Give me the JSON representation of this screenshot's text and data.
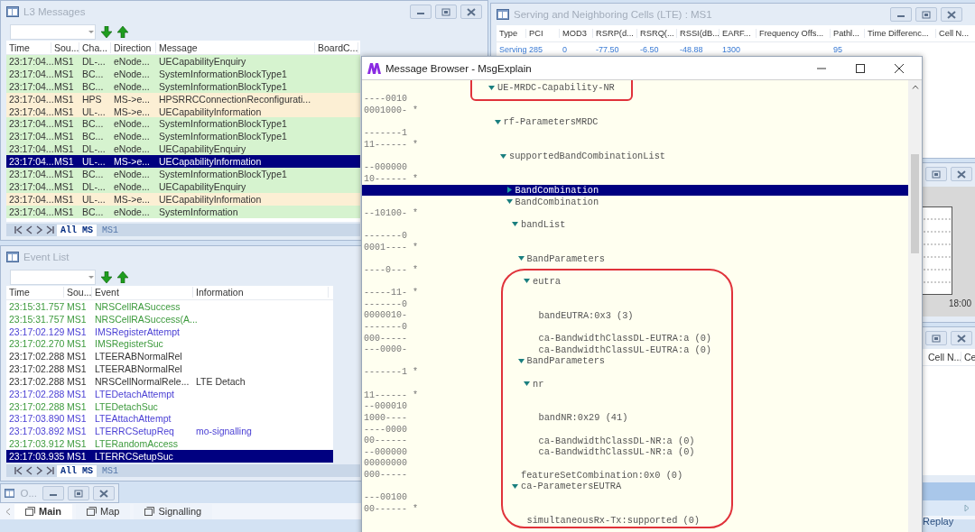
{
  "l3_messages": {
    "title": "L3 Messages",
    "columns": [
      "Time",
      "Sou...",
      "Cha...",
      "Direction",
      "Message",
      "BoardC..."
    ],
    "rows": [
      {
        "time": "23:17:04...",
        "source": "MS1",
        "channel": "DL-...",
        "direction": "eNode...",
        "message": "UECapabilityEnquiry",
        "color": "#d6f3cf",
        "selected": false
      },
      {
        "time": "23:17:04...",
        "source": "MS1",
        "channel": "BC...",
        "direction": "eNode...",
        "message": "SystemInformationBlockType1",
        "color": "#d6f3cf",
        "selected": false
      },
      {
        "time": "23:17:04...",
        "source": "MS1",
        "channel": "BC...",
        "direction": "eNode...",
        "message": "SystemInformationBlockType1",
        "color": "#d6f3cf",
        "selected": false
      },
      {
        "time": "23:17:04...",
        "source": "MS1",
        "channel": "HPS",
        "direction": "MS->e...",
        "message": "HPSRRCConnectionReconfigurati...",
        "color": "#fcefd4",
        "selected": false
      },
      {
        "time": "23:17:04...",
        "source": "MS1",
        "channel": "UL-...",
        "direction": "MS->e...",
        "message": "UECapabilityInformation",
        "color": "#fcefd4",
        "selected": false
      },
      {
        "time": "23:17:04...",
        "source": "MS1",
        "channel": "BC...",
        "direction": "eNode...",
        "message": "SystemInformationBlockType1",
        "color": "#d6f3cf",
        "selected": false
      },
      {
        "time": "23:17:04...",
        "source": "MS1",
        "channel": "BC...",
        "direction": "eNode...",
        "message": "SystemInformationBlockType1",
        "color": "#d6f3cf",
        "selected": false
      },
      {
        "time": "23:17:04...",
        "source": "MS1",
        "channel": "DL-...",
        "direction": "eNode...",
        "message": "UECapabilityEnquiry",
        "color": "#d6f3cf",
        "selected": false
      },
      {
        "time": "23:17:04...",
        "source": "MS1",
        "channel": "UL-...",
        "direction": "MS->e...",
        "message": "UECapabilityInformation",
        "selected": true
      },
      {
        "time": "23:17:04...",
        "source": "MS1",
        "channel": "BC...",
        "direction": "eNode...",
        "message": "SystemInformationBlockType1",
        "color": "#d6f3cf",
        "selected": false
      },
      {
        "time": "23:17:04...",
        "source": "MS1",
        "channel": "DL-...",
        "direction": "eNode...",
        "message": "UECapabilityEnquiry",
        "color": "#d6f3cf",
        "selected": false
      },
      {
        "time": "23:17:04...",
        "source": "MS1",
        "channel": "UL-...",
        "direction": "MS->e...",
        "message": "UECapabilityInformation",
        "color": "#fcefd4",
        "selected": false
      },
      {
        "time": "23:17:04...",
        "source": "MS1",
        "channel": "BC...",
        "direction": "eNode...",
        "message": "SystemInformation",
        "color": "#d6f3cf",
        "selected": false
      }
    ],
    "tabs": [
      {
        "label": "All MS",
        "selected": true
      },
      {
        "label": "MS1",
        "selected": false
      }
    ]
  },
  "event_list": {
    "title": "Event List",
    "columns": [
      "Time",
      "Sou...",
      "Event",
      "Information"
    ],
    "rows": [
      {
        "time": "23:15:31.757",
        "source": "MS1",
        "event": "NRSCellRASuccess",
        "color": "#3d9a3d",
        "selected": false
      },
      {
        "time": "23:15:31.757",
        "source": "MS1",
        "event": "NRSCellRASuccess(A...",
        "color": "#3d9a3d",
        "selected": false
      },
      {
        "time": "23:17:02.129",
        "source": "MS1",
        "event": "IMSRegisterAttempt",
        "color": "#4a3fd4",
        "selected": false
      },
      {
        "time": "23:17:02.270",
        "source": "MS1",
        "event": "IMSRegisterSuc",
        "color": "#3d9a3d",
        "selected": false
      },
      {
        "time": "23:17:02.288",
        "source": "MS1",
        "event": "LTEERABNormalRel",
        "color": "#333333",
        "selected": false
      },
      {
        "time": "23:17:02.288",
        "source": "MS1",
        "event": "LTEERABNormalRel",
        "color": "#333333",
        "selected": false
      },
      {
        "time": "23:17:02.288",
        "source": "MS1",
        "event": "NRSCellNormalRele...",
        "information": "LTE Detach",
        "color": "#333333",
        "selected": false
      },
      {
        "time": "23:17:02.288",
        "source": "MS1",
        "event": "LTEDetachAttempt",
        "color": "#4a3fd4",
        "selected": false
      },
      {
        "time": "23:17:02.288",
        "source": "MS1",
        "event": "LTEDetachSuc",
        "color": "#3d9a3d",
        "selected": false
      },
      {
        "time": "23:17:03.890",
        "source": "MS1",
        "event": "LTEAttachAttempt",
        "color": "#4a3fd4",
        "selected": false
      },
      {
        "time": "23:17:03.892",
        "source": "MS1",
        "event": "LTERRCSetupReq",
        "information": "mo-signalling",
        "color": "#4a3fd4",
        "selected": false
      },
      {
        "time": "23:17:03.912",
        "source": "MS1",
        "event": "LTERandomAccess",
        "color": "#3d9a3d",
        "selected": false
      },
      {
        "time": "23:17:03.935",
        "source": "MS1",
        "event": "LTERRCSetupSuc",
        "selected": true
      }
    ],
    "tabs": [
      {
        "label": "All MS",
        "selected": true
      },
      {
        "label": "MS1",
        "selected": false
      }
    ]
  },
  "serving_cells": {
    "title": "Serving and Neighboring Cells (LTE) : MS1",
    "columns": [
      "Type",
      "PCI",
      "MOD3",
      "RSRP(d...",
      "RSRQ(...",
      "RSSI(dB...",
      "EARF...",
      "Frequency Offs...",
      "Pathl...",
      "Time Differenc...",
      "Cell N..."
    ],
    "rows": [
      [
        "Serving",
        "285",
        "0",
        "-77.50",
        "-6.50",
        "-48.88",
        "1300",
        null,
        "95",
        null,
        null
      ]
    ]
  },
  "message_browser": {
    "title": "Message Browser - MsgExplain",
    "tree": [
      {
        "label": "UE-MRDC-Capability-NR",
        "expanded": true,
        "selected": false,
        "children": [
          {
            "label": "rf-ParametersMRDC",
            "bits_before": [
              "----0010",
              "0001000- *"
            ],
            "expanded": true,
            "selected": false,
            "children": [
              {
                "label": "supportedBandCombinationList",
                "bits_before": [
                  "-------1",
                  "11------ *"
                ],
                "expanded": true,
                "selected": false,
                "children": [
                  {
                    "label": "BandCombination",
                    "bits_before": [
                      "--000000",
                      "10------ *"
                    ],
                    "expanded": false,
                    "selected": true
                  },
                  {
                    "label": "BandCombination",
                    "expanded": true,
                    "selected": false,
                    "children": [
                      {
                        "label": "bandList",
                        "bits_before": [
                          "--10100- *"
                        ],
                        "expanded": true,
                        "selected": false,
                        "children": [
                          {
                            "label": "BandParameters",
                            "bits_before": [
                              "-------0",
                              "0001---- *"
                            ],
                            "expanded": true,
                            "selected": false,
                            "children": [
                              {
                                "label": "eutra",
                                "bits_before": [
                                  "----0--- *"
                                ],
                                "expanded": true,
                                "selected": false,
                                "children": [
                                  {
                                    "label": "bandEUTRA:0x3 (3)",
                                    "bits_before": [
                                      "-----11- *",
                                      "-------0"
                                    ],
                                    "bits": "0000010-",
                                    "selected": false
                                  },
                                  {
                                    "label": "ca-BandwidthClassDL-EUTRA:a (0)",
                                    "bits_before": [
                                      "-------0"
                                    ],
                                    "bits": "000-----",
                                    "selected": false
                                  },
                                  {
                                    "label": "ca-BandwidthClassUL-EUTRA:a (0)",
                                    "bits": "---0000-",
                                    "selected": false
                                  }
                                ]
                              }
                            ]
                          },
                          {
                            "label": "BandParameters",
                            "expanded": true,
                            "selected": false,
                            "children": [
                              {
                                "label": "nr",
                                "bits_before": [
                                  "-------1 *"
                                ],
                                "expanded": true,
                                "selected": false,
                                "children": [
                                  {
                                    "label": "bandNR:0x29 (41)",
                                    "bits_before": [
                                      "11------ *",
                                      "--000010"
                                    ],
                                    "bits": "1000----",
                                    "selected": false
                                  },
                                  {
                                    "label": "ca-BandwidthClassDL-NR:a (0)",
                                    "bits_before": [
                                      "----0000"
                                    ],
                                    "bits": "00------",
                                    "selected": false
                                  },
                                  {
                                    "label": "ca-BandwidthClassUL-NR:a (0)",
                                    "bits": "--000000",
                                    "selected": false
                                  }
                                ]
                              }
                            ]
                          }
                        ]
                      },
                      {
                        "label": "featureSetCombination:0x0 (0)",
                        "bits_before": [
                          "00000000"
                        ],
                        "bits": "000-----",
                        "selected": false
                      },
                      {
                        "label": "ca-ParametersEUTRA",
                        "expanded": true,
                        "selected": false,
                        "children": [
                          {
                            "label": "simultaneousRx-Tx:supported (0)",
                            "bits_before": [
                              "---00100",
                              "00------ *"
                            ],
                            "selected": false
                          }
                        ]
                      }
                    ]
                  }
                ]
              }
            ]
          }
        ]
      }
    ]
  },
  "chart_window": {
    "x_tick_label": "18:00"
  },
  "cells_window": {
    "columns": [
      "Cell N...",
      "Ce"
    ]
  },
  "minimized_window": {
    "title": "O..."
  },
  "bottom_tabs": [
    {
      "label": "Main",
      "selected": true
    },
    {
      "label": "Map",
      "selected": false
    },
    {
      "label": "Signalling",
      "selected": false
    }
  ],
  "replay_label": "Replay"
}
